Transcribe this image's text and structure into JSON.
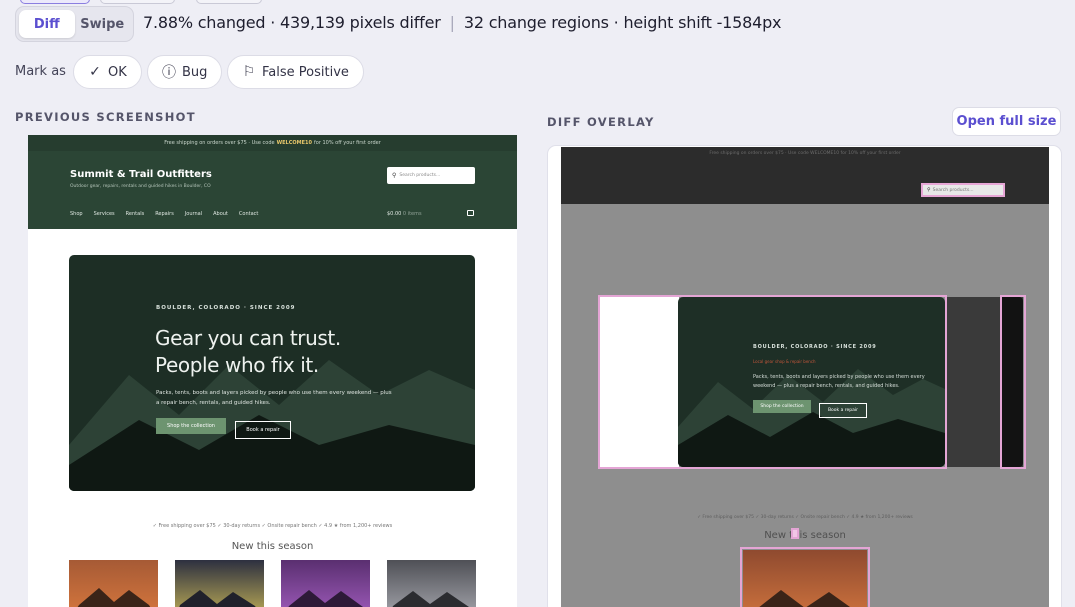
{
  "view_toggle": {
    "options": [
      "Diff",
      "Swipe"
    ],
    "active": "Diff"
  },
  "stats": {
    "changed": "7.88% changed · 439,139 pixels differ",
    "separator": "|",
    "regions": "32 change regions · height shift -1584px"
  },
  "mark_as": {
    "label": "Mark as",
    "buttons": [
      {
        "label": "OK",
        "icon": "check-icon"
      },
      {
        "label": "Bug",
        "icon": "alert-circle-icon"
      },
      {
        "label": "False Positive",
        "icon": "flag-icon"
      }
    ]
  },
  "previous": {
    "label": "PREVIOUS SCREENSHOT",
    "site": {
      "announcement": {
        "pre": "Free shipping on orders over $75 · Use code",
        "code": "WELCOME10",
        "post": "for 10% off your first order"
      },
      "brand": "Summit & Trail Outfitters",
      "tagline": "Outdoor gear, repairs, rentals and guided hikes in Boulder, CO",
      "search_placeholder": "Search products...",
      "nav": [
        "Shop",
        "Services",
        "Rentals",
        "Repairs",
        "Journal",
        "About",
        "Contact"
      ],
      "cart_amount": "$0.00",
      "cart_items": "0 items",
      "hero": {
        "eyebrow": "BOULDER, COLORADO · SINCE 2009",
        "heading": "Gear you can trust. People who fix it.",
        "body": "Packs, tents, boots and layers picked by people who use them every weekend — plus a repair bench, rentals, and guided hikes.",
        "primary_cta": "Shop the collection",
        "secondary_cta": "Book a repair"
      },
      "perks": "✓ Free shipping over $75   ✓ 30-day returns   ✓ Onsite repair bench   ✓ 4.9 ★ from 1,200+ reviews",
      "section_title": "New this season"
    }
  },
  "diff": {
    "label": "DIFF OVERLAY",
    "open_button": "Open full size",
    "hero_subline": "Local gear shop & repair bench"
  },
  "colors": {
    "accent": "#5b4fd0",
    "highlight": "#e4a5d5",
    "site_green": "#2b4535"
  }
}
